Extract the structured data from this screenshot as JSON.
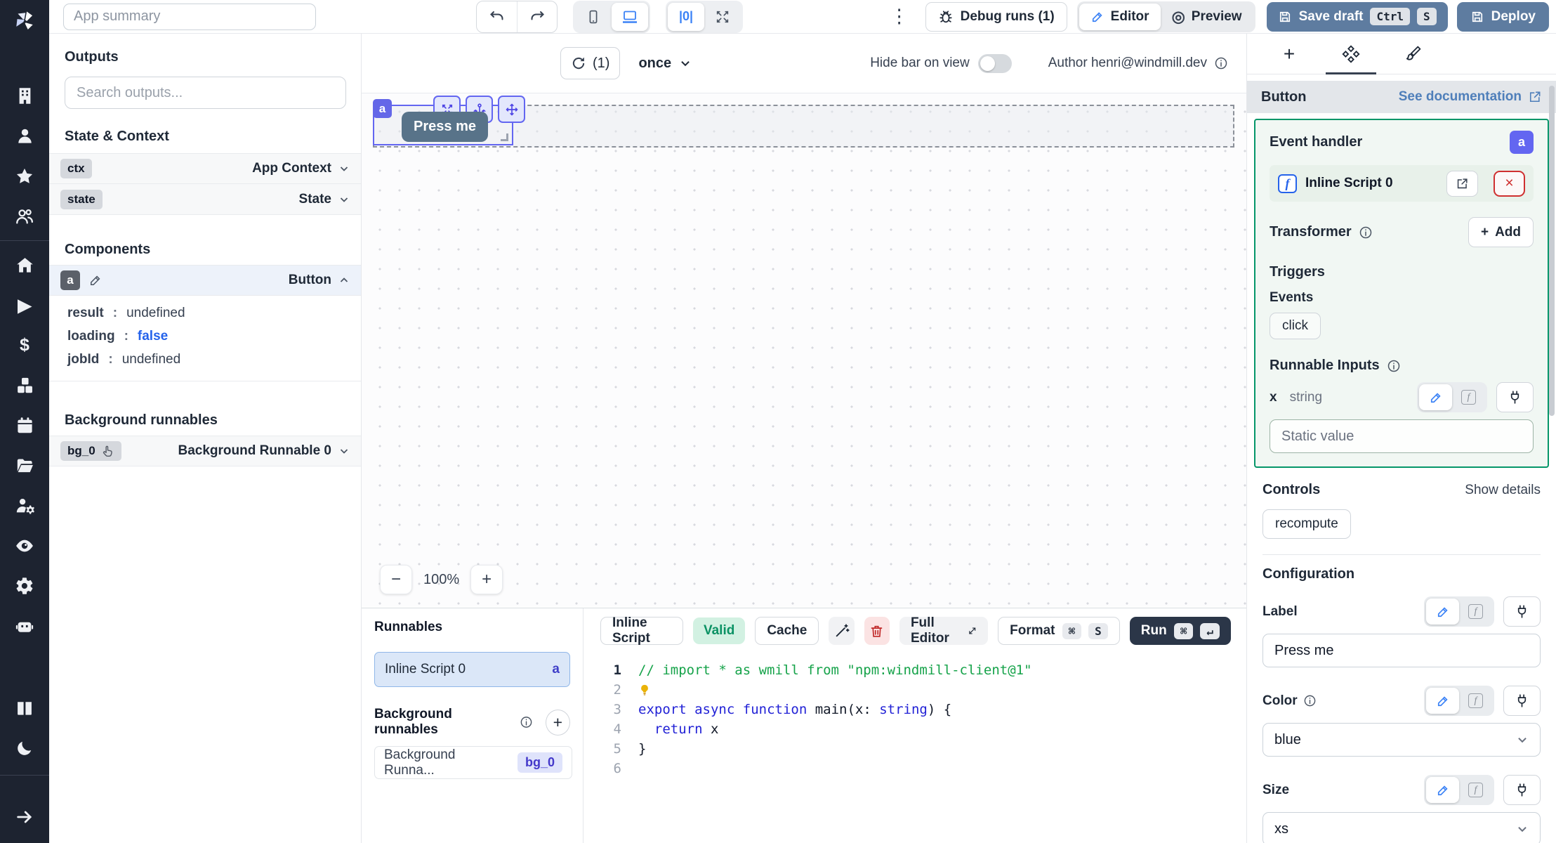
{
  "topbar": {
    "app_summary_placeholder": "App summary",
    "center_layout_glyph": "|0|",
    "debug_runs": "Debug runs (1)",
    "editor": "Editor",
    "preview": "Preview",
    "save_draft": "Save draft",
    "kbd_ctrl": "Ctrl",
    "kbd_s": "S",
    "deploy": "Deploy"
  },
  "sidebar": {
    "icons": [
      "windmill-logo",
      "building",
      "user",
      "star",
      "users",
      "home",
      "play",
      "dollar",
      "cubes",
      "calendar",
      "folder-open",
      "user-gear",
      "eye",
      "gear",
      "robot",
      "book",
      "moon",
      "arrow-right"
    ],
    "dollar_glyph": "$",
    "play_glyph": "▶"
  },
  "outputs": {
    "title": "Outputs",
    "search_placeholder": "Search outputs...",
    "state_context_title": "State & Context",
    "ctx_badge": "ctx",
    "ctx_label": "App Context",
    "state_badge": "state",
    "state_label": "State",
    "components_title": "Components",
    "comp_badge": "a",
    "comp_label": "Button",
    "sep": ":",
    "result_key": "result",
    "result_val": "undefined",
    "loading_key": "loading",
    "loading_val": "false",
    "jobid_key": "jobId",
    "jobid_val": "undefined",
    "background_title": "Background runnables",
    "bg_badge": "bg_0",
    "bg_label": "Background Runnable 0"
  },
  "canvas": {
    "refresh_count": "(1)",
    "schedule": "once",
    "hide_bar_label": "Hide bar on view",
    "author": "Author henri@windmill.dev",
    "tag": "a",
    "button_label": "Press me",
    "zoom_out": "−",
    "zoom_level": "100%",
    "zoom_in": "+"
  },
  "runnables": {
    "title": "Runnables",
    "inline_label": "Inline Script 0",
    "inline_badge": "a",
    "bg_title": "Background runnables",
    "bg_add": "+",
    "bg_label": "Background Runna...",
    "bg_badge": "bg_0"
  },
  "editor": {
    "tab": "Inline Script",
    "valid": "Valid",
    "cache": "Cache",
    "full_editor": "Full Editor",
    "format": "Format",
    "kbd_cmd": "⌘",
    "kbd_s": "S",
    "run": "Run",
    "kbd_enter": "↵",
    "ln": [
      "1",
      "2",
      "3",
      "4",
      "5",
      "6"
    ],
    "code": {
      "l1": "// import * as wmill from \"npm:windmill-client@1\"",
      "l3a": "export",
      "l3b": " ",
      "l3c": "async",
      "l3d": " ",
      "l3e": "function",
      "l3f": " main(x: ",
      "l3g": "string",
      "l3h": ") {",
      "l4a": "  ",
      "l4b": "return",
      "l4c": " x",
      "l5": "}"
    }
  },
  "panel": {
    "component_type": "Button",
    "see_documentation": "See documentation",
    "event_handler": "Event handler",
    "eh_badge": "a",
    "script_label": "Inline Script 0",
    "transformer": "Transformer",
    "add_plus": "+",
    "add": "Add",
    "triggers": "Triggers",
    "events_label": "Events",
    "event_click": "click",
    "runnable_inputs": "Runnable Inputs",
    "input_name": "x",
    "input_type": "string",
    "static_placeholder": "Static value",
    "controls": "Controls",
    "show_details": "Show details",
    "recompute": "recompute",
    "configuration": "Configuration",
    "label_label": "Label",
    "label_value": "Press me",
    "color_label": "Color",
    "color_value": "blue",
    "size_label": "Size",
    "size_value": "xs"
  },
  "colors": {
    "accent_blue": "#3b82f6",
    "indigo_selection": "#6366f1",
    "slate_action_button": "#5e7ca0",
    "dark_run_button": "#2b3648",
    "event_handler_green": "#059669",
    "valid_green": "#0b9264",
    "danger_red": "#cf3030",
    "canvas_button_slate": "#587389",
    "code_keyword": "#2222d6",
    "code_comment": "#16a34a"
  }
}
